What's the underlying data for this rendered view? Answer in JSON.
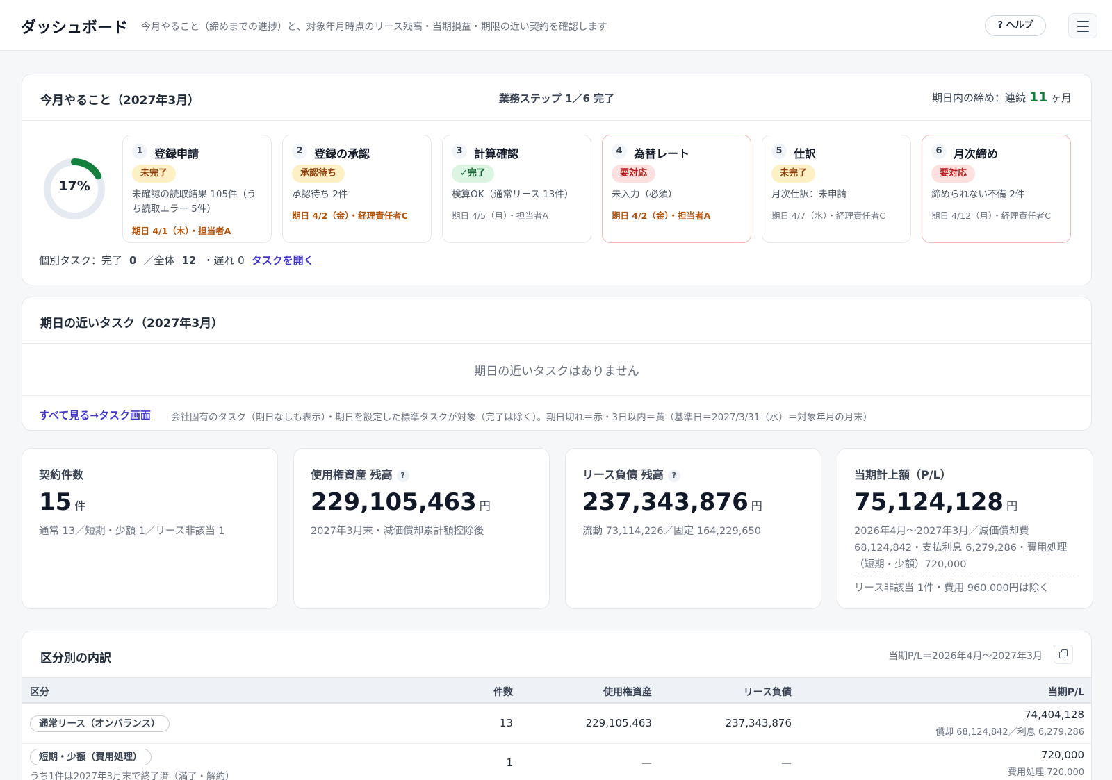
{
  "header": {
    "title": "ダッシュボード",
    "subtitle": "今月やること（締めまでの進捗）と、対象年月時点のリース残高・当期損益・期限の近い契約を確認します",
    "help_label": "? ヘルプ"
  },
  "tasks_card": {
    "title": "今月やること（2027年3月）",
    "step_summary": "業務ステップ 1／6 完了",
    "streak_prefix": "期日内の締め：連続",
    "streak_value": "11",
    "streak_suffix": "ヶ月",
    "progress_label": "17%",
    "progress": 0.17,
    "steps": [
      {
        "num": "1",
        "name": "登録申請",
        "badge": "未完了",
        "badge_color": "yellow",
        "desc": "未確認の読取結果 105件（うち読取エラー 5件）",
        "due": "期日 4/1（木）・担当者A",
        "due_warn": true
      },
      {
        "num": "2",
        "name": "登録の承認",
        "badge": "承認待ち",
        "badge_color": "yellow",
        "desc": "承認待ち 2件",
        "due": "期日 4/2（金）・経理責任者C",
        "due_warn": true
      },
      {
        "num": "3",
        "name": "計算確認",
        "badge": "✓完了",
        "badge_color": "green",
        "desc": "検算OK（通常リース 13件）",
        "due": "期日 4/5（月）・担当者A",
        "due_warn": false
      },
      {
        "num": "4",
        "name": "為替レート",
        "badge": "要対応",
        "badge_color": "red",
        "desc": "未入力（必須）",
        "due": "期日 4/2（金）・担当者A",
        "due_warn": true
      },
      {
        "num": "5",
        "name": "仕訳",
        "badge": "未完了",
        "badge_color": "yellow",
        "desc": "月次仕訳：未申請",
        "due": "期日 4/7（水）・経理責任者C",
        "due_warn": false
      },
      {
        "num": "6",
        "name": "月次締め",
        "badge": "要対応",
        "badge_color": "red",
        "desc": "締められない不備 2件",
        "due": "期日 4/12（月）・経理責任者C",
        "due_warn": false
      }
    ],
    "footer": {
      "prefix": "個別タスク：完了",
      "done": "0",
      "total_label": "／全体",
      "total": "12",
      "late": "・遅れ 0",
      "link": "タスクを開く"
    }
  },
  "due_card": {
    "title": "期日の近いタスク（2027年3月）",
    "empty": "期日の近いタスクはありません",
    "link": "すべて見る→タスク画面",
    "note": "会社固有のタスク（期日なしも表示）・期日を設定した標準タスクが対象（完了は除く）。期日切れ＝赤・3日以内＝黄（基準日＝2027/3/31（水）＝対象年月の月末）"
  },
  "kpis": [
    {
      "label": "契約件数",
      "help": false,
      "value": "15",
      "unit": "件",
      "sub": "通常 13／短期・少額 1／リース非該当 1",
      "extra": ""
    },
    {
      "label": "使用権資産 残高",
      "help": true,
      "value": "229,105,463",
      "unit": "円",
      "sub": "2027年3月末・減価償却累計額控除後",
      "extra": ""
    },
    {
      "label": "リース負債 残高",
      "help": true,
      "value": "237,343,876",
      "unit": "円",
      "sub": "流動 73,114,226／固定 164,229,650",
      "extra": ""
    },
    {
      "label": "当期計上額（P/L）",
      "help": false,
      "value": "75,124,128",
      "unit": "円",
      "sub": "2026年4月〜2027年3月／減価償却費 68,124,842・支払利息 6,279,286・費用処理（短期・少額）720,000",
      "extra": "リース非該当 1件・費用 960,000円は除く"
    }
  ],
  "breakdown": {
    "title": "区分別の内訳",
    "period": "当期P/L＝2026年4月〜2027年3月",
    "columns": [
      "区分",
      "件数",
      "使用権資産",
      "リース負債",
      "当期P/L"
    ],
    "rows": [
      {
        "category": "通常リース（オンバランス）",
        "note": "",
        "count": "13",
        "rou": "229,105,463",
        "liability": "237,343,876",
        "pl": "74,404,128",
        "pl_detail": "償却 68,124,842／利息 6,279,286"
      },
      {
        "category": "短期・少額（費用処理）",
        "note": "うち1件は2027年3月末で終了済（満了・解約）",
        "count": "1",
        "rou": "—",
        "liability": "—",
        "pl": "720,000",
        "pl_detail": "費用処理 720,000"
      }
    ]
  },
  "colors": {
    "accent_green": "#15803d",
    "link": "#4338ca",
    "alert_border": "#f3b8b8"
  }
}
